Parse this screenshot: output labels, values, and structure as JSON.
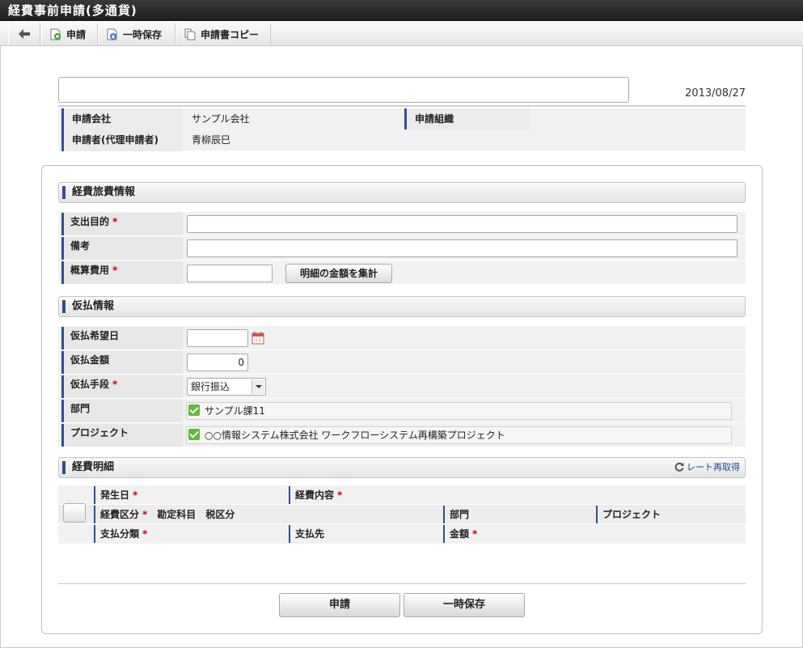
{
  "window": {
    "title": "経費事前申請(多通貨)"
  },
  "toolbar": {
    "back_label": "",
    "apply_label": "申請",
    "save_label": "一時保存",
    "copy_label": "申請書コピー"
  },
  "header": {
    "date": "2013/08/27",
    "company_label": "申請会社",
    "company_value": "サンプル会社",
    "org_label": "申請組織",
    "org_value": "",
    "applicant_label": "申請者(代理申請者)",
    "applicant_value": "青柳辰巳"
  },
  "expense_info": {
    "section_title": "経費旅費情報",
    "purpose_label": "支出目的",
    "note_label": "備考",
    "estimate_label": "概算費用",
    "sum_button": "明細の金額を集計"
  },
  "advance": {
    "section_title": "仮払情報",
    "date_label": "仮払希望日",
    "amount_label": "仮払金額",
    "amount_value": "0",
    "method_label": "仮払手段",
    "method_value": "銀行振込",
    "dept_label": "部門",
    "dept_value": "サンプル課11",
    "project_label": "プロジェクト",
    "project_value": "○○情報システム株式会社 ワークフローシステム再構築プロジェクト"
  },
  "detail": {
    "section_title": "経費明細",
    "refresh_label": "レート再取得",
    "occur_date": "発生日",
    "content": "経費内容",
    "category": "経費区分",
    "account": "勘定科目",
    "tax": "税区分",
    "dept": "部門",
    "project": "プロジェクト",
    "pay_class": "支払分類",
    "payee": "支払先",
    "amount": "金額"
  },
  "footer": {
    "apply_label": "申請",
    "save_label": "一時保存"
  },
  "required_mark": "*"
}
